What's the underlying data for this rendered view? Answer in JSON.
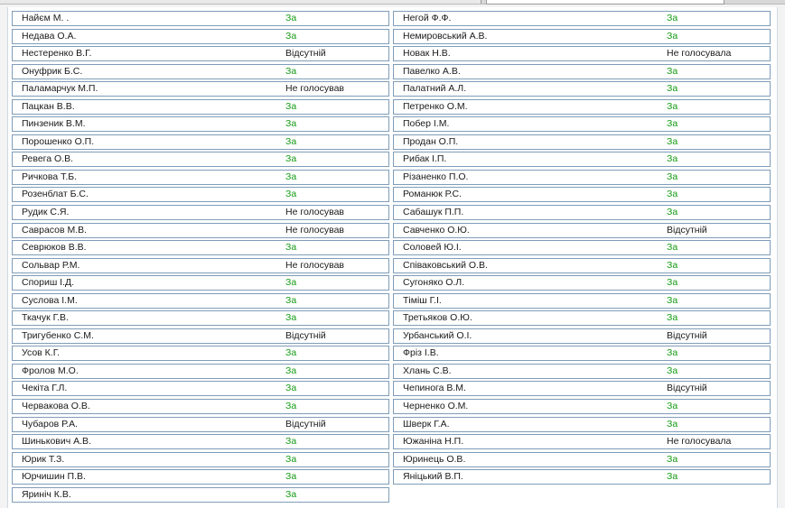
{
  "results": {
    "left": [
      {
        "name": "Найєм М. .",
        "vote": "За"
      },
      {
        "name": "Недава О.А.",
        "vote": "За"
      },
      {
        "name": "Нестеренко В.Г.",
        "vote": "Відсутній"
      },
      {
        "name": "Онуфрик Б.С.",
        "vote": "За"
      },
      {
        "name": "Паламарчук М.П.",
        "vote": "Не голосував"
      },
      {
        "name": "Пацкан В.В.",
        "vote": "За"
      },
      {
        "name": "Пинзеник В.М.",
        "vote": "За"
      },
      {
        "name": "Порошенко О.П.",
        "vote": "За"
      },
      {
        "name": "Ревега О.В.",
        "vote": "За"
      },
      {
        "name": "Ричкова Т.Б.",
        "vote": "За"
      },
      {
        "name": "Розенблат Б.С.",
        "vote": "За"
      },
      {
        "name": "Рудик С.Я.",
        "vote": "Не голосував"
      },
      {
        "name": "Саврасов М.В.",
        "vote": "Не голосував"
      },
      {
        "name": "Севрюков В.В.",
        "vote": "За"
      },
      {
        "name": "Сольвар Р.М.",
        "vote": "Не голосував"
      },
      {
        "name": "Спориш І.Д.",
        "vote": "За"
      },
      {
        "name": "Суслова І.М.",
        "vote": "За"
      },
      {
        "name": "Ткачук Г.В.",
        "vote": "За"
      },
      {
        "name": "Тригубенко С.М.",
        "vote": "Відсутній"
      },
      {
        "name": "Усов К.Г.",
        "vote": "За"
      },
      {
        "name": "Фролов М.О.",
        "vote": "За"
      },
      {
        "name": "Чекіта Г.Л.",
        "vote": "За"
      },
      {
        "name": "Червакова О.В.",
        "vote": "За"
      },
      {
        "name": "Чубаров Р.А.",
        "vote": "Відсутній"
      },
      {
        "name": "Шинькович А.В.",
        "vote": "За"
      },
      {
        "name": "Юрик Т.З.",
        "vote": "За"
      },
      {
        "name": "Юрчишин П.В.",
        "vote": "За"
      },
      {
        "name": "Яриніч К.В.",
        "vote": "За"
      }
    ],
    "right": [
      {
        "name": "Негой Ф.Ф.",
        "vote": "За"
      },
      {
        "name": "Немировський А.В.",
        "vote": "За"
      },
      {
        "name": "Новак Н.В.",
        "vote": "Не голосувала"
      },
      {
        "name": "Павелко А.В.",
        "vote": "За"
      },
      {
        "name": "Палатний А.Л.",
        "vote": "За"
      },
      {
        "name": "Петренко О.М.",
        "vote": "За"
      },
      {
        "name": "Побер І.М.",
        "vote": "За"
      },
      {
        "name": "Продан О.П.",
        "vote": "За"
      },
      {
        "name": "Рибак І.П.",
        "vote": "За"
      },
      {
        "name": "Різаненко П.О.",
        "vote": "За"
      },
      {
        "name": "Романюк Р.С.",
        "vote": "За"
      },
      {
        "name": "Сабашук П.П.",
        "vote": "За"
      },
      {
        "name": "Савченко О.Ю.",
        "vote": "Відсутній"
      },
      {
        "name": "Соловей Ю.І.",
        "vote": "За"
      },
      {
        "name": "Співаковський О.В.",
        "vote": "За"
      },
      {
        "name": "Сугоняко О.Л.",
        "vote": "За"
      },
      {
        "name": "Тіміш Г.І.",
        "vote": "За"
      },
      {
        "name": "Третьяков О.Ю.",
        "vote": "За"
      },
      {
        "name": "Урбанський О.І.",
        "vote": "Відсутній"
      },
      {
        "name": "Фріз І.В.",
        "vote": "За"
      },
      {
        "name": "Хлань С.В.",
        "vote": "За"
      },
      {
        "name": "Чепинога В.М.",
        "vote": "Відсутній"
      },
      {
        "name": "Черненко О.М.",
        "vote": "За"
      },
      {
        "name": "Шверк Г.А.",
        "vote": "За"
      },
      {
        "name": "Южаніна Н.П.",
        "vote": "Не голосувала"
      },
      {
        "name": "Юринець О.В.",
        "vote": "За"
      },
      {
        "name": "Яніцький В.П.",
        "vote": "За"
      }
    ]
  },
  "colors": {
    "vote_for": "#119a11",
    "vote_other": "#1a1a1a",
    "row_border": "#7f9db9"
  }
}
